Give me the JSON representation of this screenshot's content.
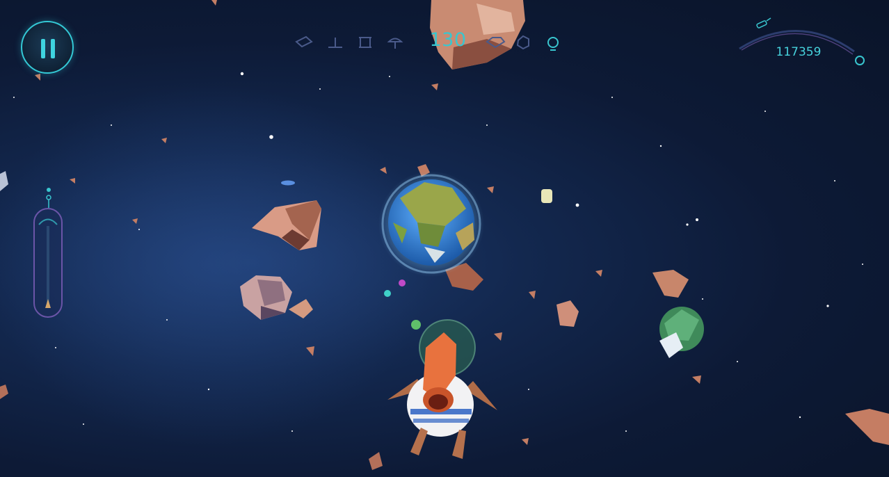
{
  "hud": {
    "score": "130",
    "currency": "117359",
    "pause_icon": "pause-icon"
  },
  "resources": {
    "icons": [
      "diamond-outline-icon",
      "plus-icon",
      "tray-icon",
      "mushroom-icon",
      "crystal-outline-icon",
      "hexagon-outline-icon",
      "lightbulb-icon"
    ]
  },
  "colors": {
    "accent": "#39c6cf",
    "space_dark": "#0a1429",
    "asteroid": "#c97a5e",
    "planet_water": "#2e7cc7",
    "planet_land": "#9aa64a"
  }
}
